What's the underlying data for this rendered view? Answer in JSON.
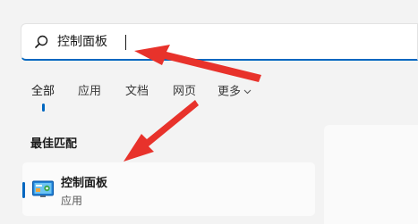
{
  "search": {
    "value": "控制面板",
    "icon": "search-icon"
  },
  "tabs": [
    {
      "label": "全部",
      "active": true
    },
    {
      "label": "应用",
      "active": false
    },
    {
      "label": "文档",
      "active": false
    },
    {
      "label": "网页",
      "active": false
    },
    {
      "label": "更多",
      "active": false,
      "has_dropdown": true
    }
  ],
  "best_match": {
    "title": "最佳匹配",
    "result": {
      "name": "控制面板",
      "type": "应用",
      "icon": "control-panel-icon"
    }
  },
  "colors": {
    "accent": "#0067c0",
    "annotation_arrow": "#e8322b"
  }
}
